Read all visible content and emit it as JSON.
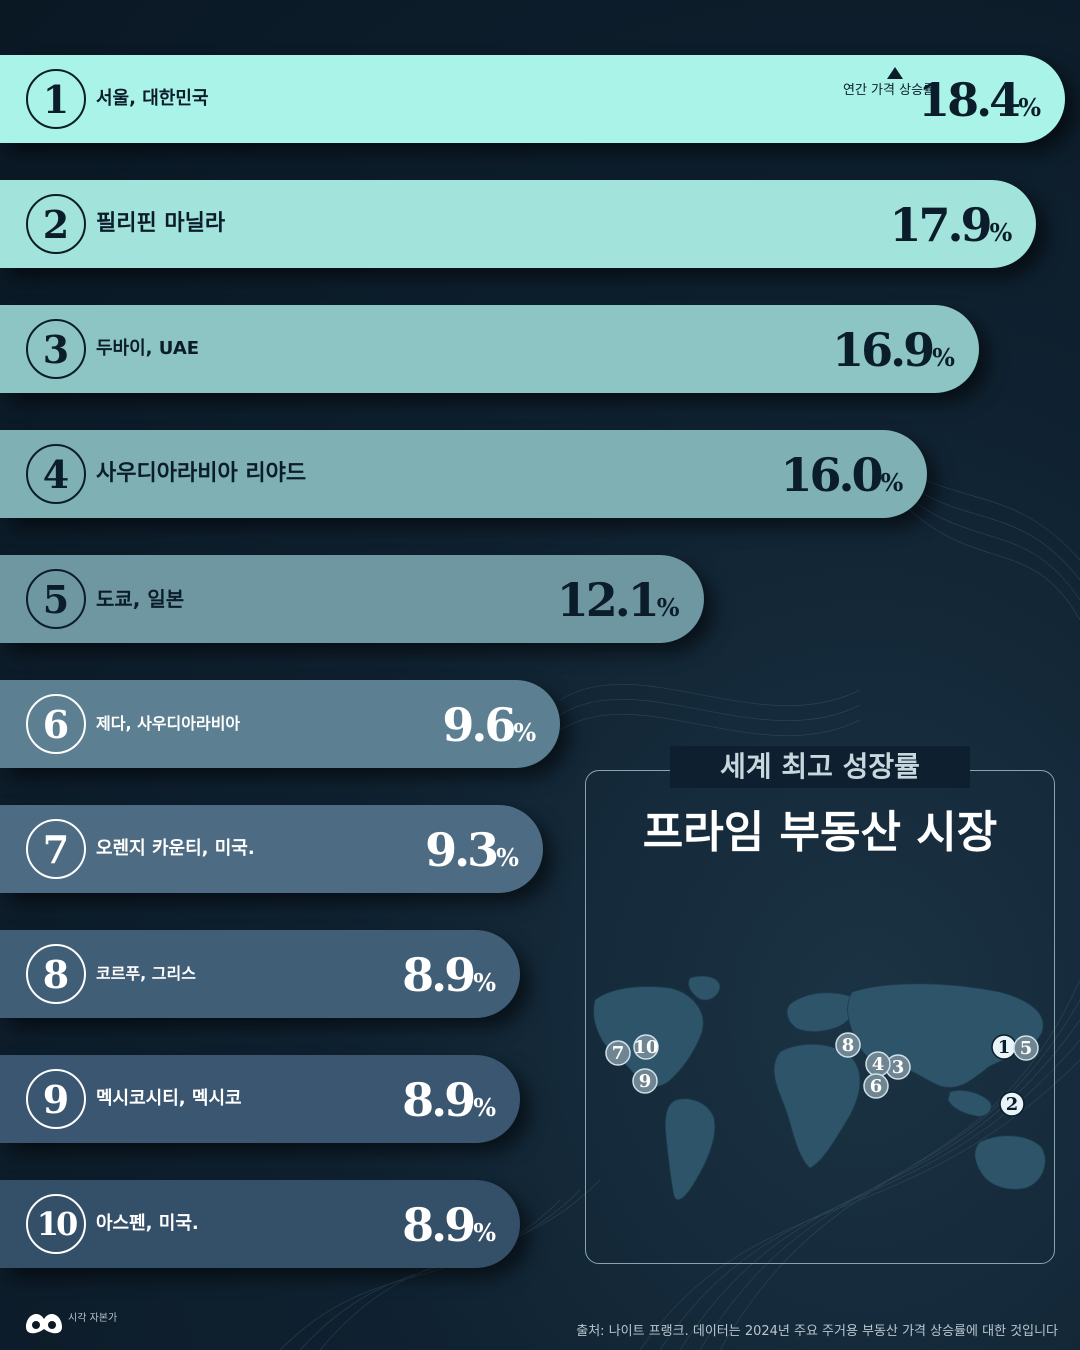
{
  "chart_data": {
    "type": "bar",
    "orientation": "horizontal",
    "title": "프라임 부동산 시장",
    "subtitle": "세계 최고 성장률",
    "annotation": "연간 가격 상승률",
    "unit": "%",
    "categories": [
      "서울, 대한민국",
      "필리핀 마닐라",
      "두바이, UAE",
      "사우디아라비아 리야드",
      "도쿄, 일본",
      "제다, 사우디아라비아",
      "오렌지 카운티, 미국.",
      "코르푸, 그리스",
      "멕시코시티, 멕시코",
      "아스펜, 미국."
    ],
    "ranks": [
      "1",
      "2",
      "3",
      "4",
      "5",
      "6",
      "7",
      "8",
      "9",
      "10"
    ],
    "values": [
      18.4,
      17.9,
      16.9,
      16.0,
      12.1,
      9.6,
      9.3,
      8.9,
      8.9,
      8.9
    ],
    "value_labels": [
      "18.4",
      "17.9",
      "16.9",
      "16.0",
      "12.1",
      "9.6",
      "9.3",
      "8.9",
      "8.9",
      "8.9"
    ],
    "bar_colors": [
      "#a9f3e8",
      "#a2e3dc",
      "#8cc5c3",
      "#7eb0b4",
      "#6e97a2",
      "#5d7f92",
      "#4d6c83",
      "#415e77",
      "#3a5670",
      "#344f68"
    ],
    "light_text_from_rank": 6,
    "grid": false,
    "legend": "none"
  },
  "map": {
    "marker_labels": [
      "1",
      "2",
      "3",
      "4",
      "5",
      "6",
      "7",
      "8",
      "9",
      "10"
    ]
  },
  "source": "출처: 나이트 프랭크. 데이터는 2024년 주요 주거용 부동산 가격 상승률에 대한 것입니다",
  "brand": "시각 자본가"
}
